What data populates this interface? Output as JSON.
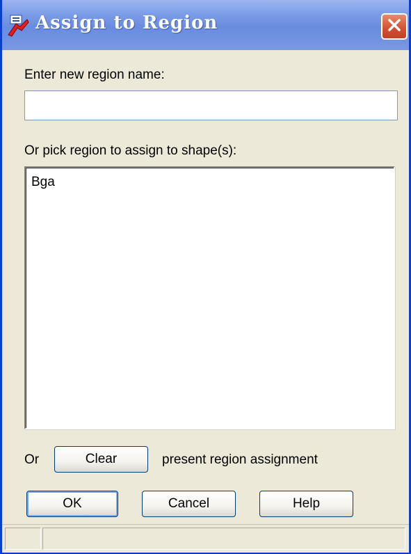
{
  "window": {
    "title": "Assign to Region",
    "app_icon": "autocad-app-icon",
    "close_icon": "close-icon"
  },
  "new_region": {
    "label": "Enter new region name:",
    "value": "",
    "placeholder": ""
  },
  "pick_region": {
    "label": "Or pick region to assign to shape(s):",
    "items": [
      "Bga"
    ]
  },
  "clear_row": {
    "prefix": "Or",
    "button_label": "Clear",
    "suffix": "present region assignment"
  },
  "buttons": {
    "ok": "OK",
    "cancel": "Cancel",
    "help": "Help"
  },
  "colors": {
    "titlebar": "#7A9BE6",
    "close_button": "#D3502F",
    "dialog_background": "#ECE9D8"
  }
}
